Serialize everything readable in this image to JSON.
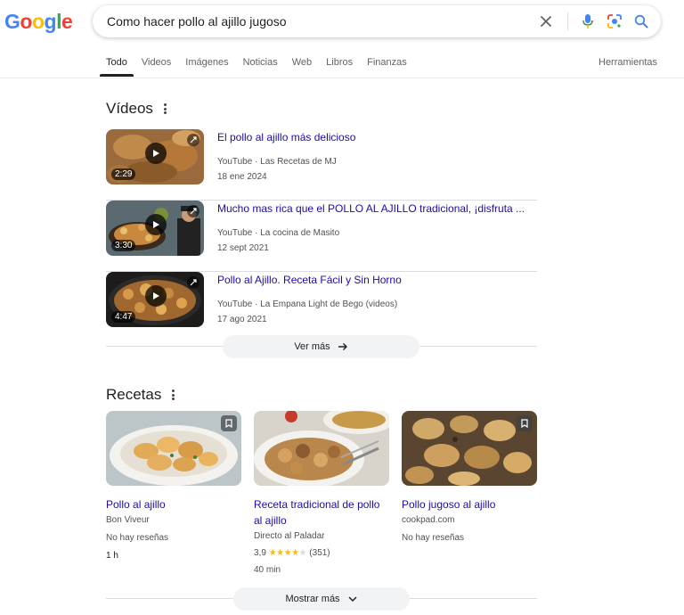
{
  "logo": {
    "letters": [
      "G",
      "o",
      "o",
      "g",
      "l",
      "e"
    ],
    "colors": [
      "#4285f4",
      "#ea4335",
      "#fbbc04",
      "#4285f4",
      "#34a853",
      "#ea4335"
    ]
  },
  "search": {
    "query": "Como hacer pollo al ajillo jugoso",
    "icons": [
      "close-icon",
      "mic-icon",
      "lens-icon",
      "search-icon"
    ]
  },
  "tabs": [
    "Todo",
    "Videos",
    "Imágenes",
    "Noticias",
    "Web",
    "Libros",
    "Finanzas"
  ],
  "active_tab": "Todo",
  "tools_label": "Herramientas",
  "videos": {
    "title": "Vídeos",
    "items": [
      {
        "title": "El pollo al ajillo más delicioso",
        "source": "YouTube · Las Recetas de MJ",
        "date": "18 ene 2024",
        "duration": "2:29"
      },
      {
        "title": "Mucho mas rica que el POLLO AL AJILLO tradicional, ¡disfruta ...",
        "source": "YouTube · La cocina de Masito",
        "date": "12 sept 2021",
        "duration": "3:30"
      },
      {
        "title": "Pollo al Ajillo. Receta Fácil y Sin Horno",
        "source": "YouTube · La Empana Light de Bego (videos)",
        "date": "17 ago 2021",
        "duration": "4:47"
      }
    ],
    "more_label": "Ver más"
  },
  "recipes": {
    "title": "Recetas",
    "items": [
      {
        "title": "Pollo al ajillo",
        "source": "Bon Viveur",
        "reviews": "No hay reseñas",
        "time": "1 h"
      },
      {
        "title": "Receta tradicional de pollo al ajillo",
        "source": "Directo al Paladar",
        "rating": "3,9",
        "stars": "★★★★",
        "star_empty": "★",
        "count": "(351)",
        "time": "40 min"
      },
      {
        "title": "Pollo jugoso al ajillo",
        "source": "cookpad.com",
        "reviews": "No hay reseñas"
      }
    ],
    "more_label": "Mostrar más"
  }
}
